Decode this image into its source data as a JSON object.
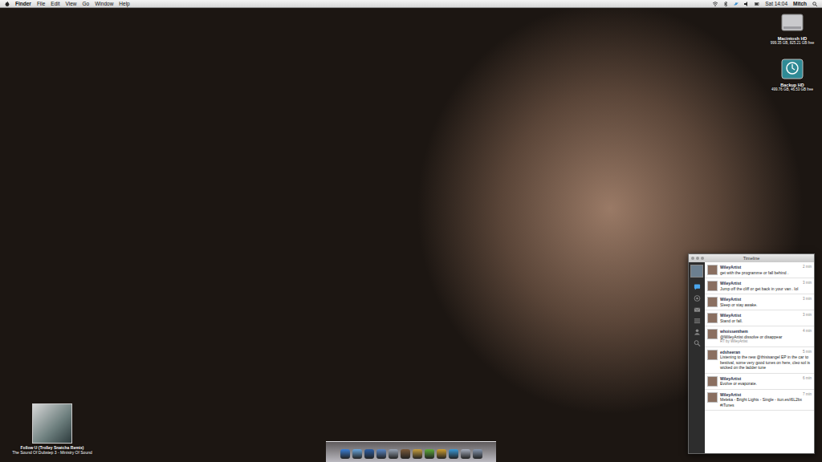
{
  "menu_bar": {
    "app": "Finder",
    "items": [
      "File",
      "Edit",
      "View",
      "Go",
      "Window",
      "Help"
    ],
    "clock": "Sat 14:04",
    "user": "Mitch"
  },
  "desktop_icons": [
    {
      "label": "Macintosh HD",
      "detail": "999.35 GB, 825.21 GB free",
      "kind": "disk"
    },
    {
      "label": "Backup HD",
      "detail": "499.76 GB, 46.53 GB free",
      "kind": "backup"
    }
  ],
  "now_playing": {
    "title": "Follow U (Trolley Snatcha Remix)",
    "subtitle": "The Sound Of Dubstep 3 - Ministry Of Sound"
  },
  "timeline": {
    "title": "Timeline",
    "sidebar_tabs": [
      {
        "kind": "timeline",
        "selected": true
      },
      {
        "kind": "mentions",
        "selected": false
      },
      {
        "kind": "messages",
        "selected": false
      },
      {
        "kind": "lists",
        "selected": false
      },
      {
        "kind": "profile",
        "selected": false
      },
      {
        "kind": "search",
        "selected": false
      }
    ],
    "tweets": [
      {
        "user": "WileyArtist",
        "text": "get with the programme or fall behind .",
        "time": "2 min"
      },
      {
        "user": "WileyArtist",
        "text": "Jump off the cliff or get back in your van .  lol",
        "time": "3 min"
      },
      {
        "user": "WileyArtist",
        "text": "Sleep or stay awake.",
        "time": "3 min"
      },
      {
        "user": "WileyArtist",
        "text": "Stand or fall.",
        "time": "3 min"
      },
      {
        "user": "whoissenthem",
        "text": "@WileyArtist dissolve or disappear",
        "time": "4 min",
        "retweeted_by": "RT by WileyArtist"
      },
      {
        "user": "edsheeran",
        "text": "Listening to the new @thisisangel EP in the car to bestival, some very good tunes on here, cleo sol is wicked on the ladder tune",
        "time": "5 min"
      },
      {
        "user": "WileyArtist",
        "text": "Evolve or evaporate.",
        "time": "6 min"
      },
      {
        "user": "WileyArtist",
        "text": "Meleka - Bright Lights - Single - itun.es/i6L2bx #iTunes",
        "time": "7 min"
      }
    ]
  }
}
